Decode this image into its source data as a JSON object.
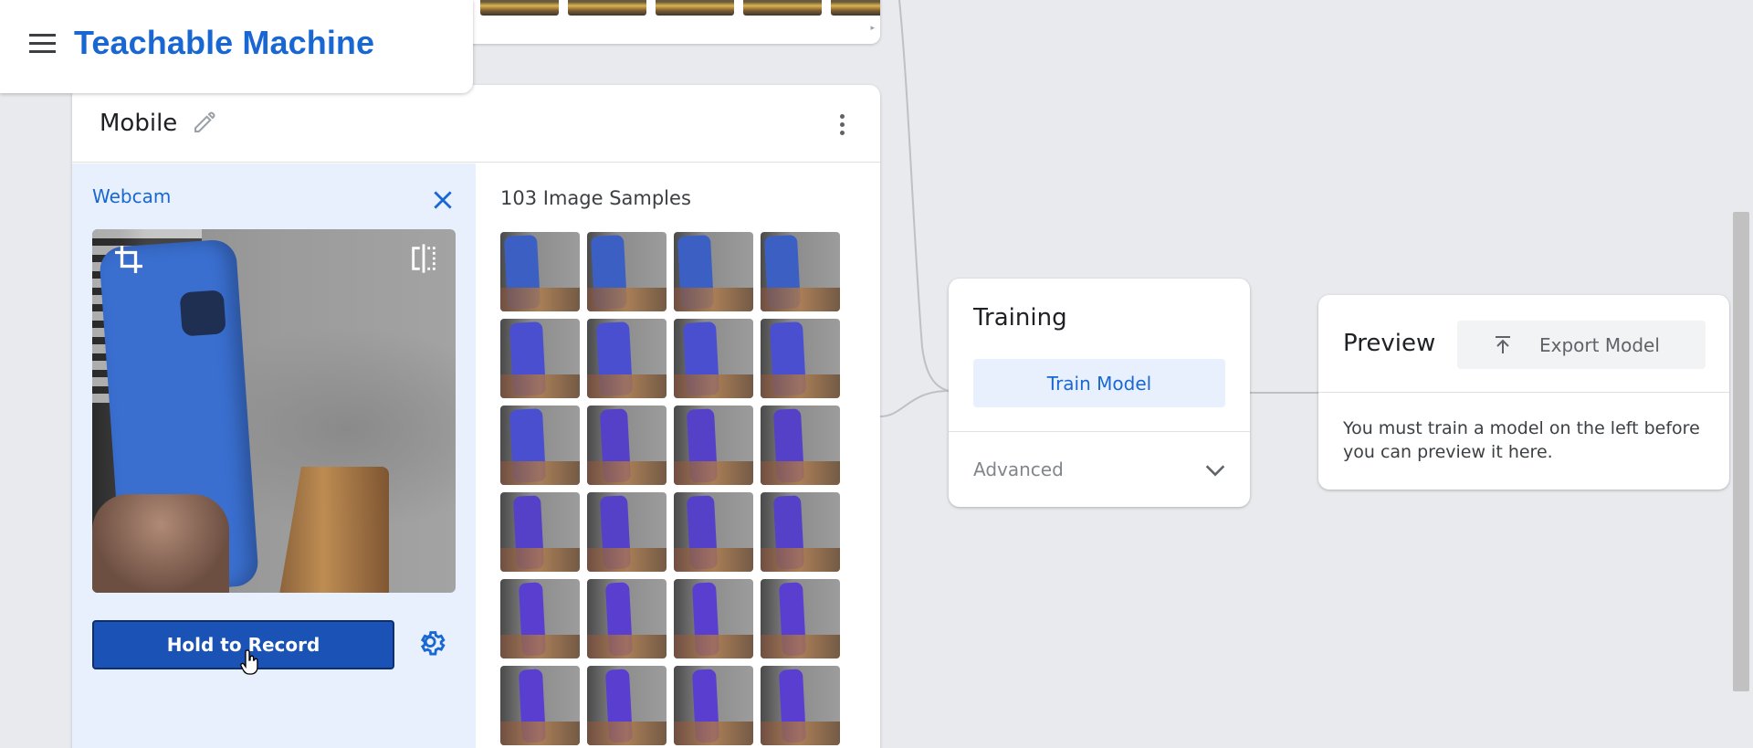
{
  "app": {
    "title": "Teachable Machine"
  },
  "class_card": {
    "name": "Mobile",
    "webcam": {
      "title": "Webcam",
      "record_label": "Hold to Record"
    },
    "samples": {
      "count_label": "103 Image Samples"
    }
  },
  "training": {
    "title": "Training",
    "train_label": "Train Model",
    "advanced_label": "Advanced"
  },
  "preview": {
    "title": "Preview",
    "export_label": "Export Model",
    "message": "You must train a model on the left before you can preview it here."
  },
  "colors": {
    "accent": "#1967d2",
    "record_button": "#1a53b5",
    "panel_bg": "#e8f0fe",
    "page_bg": "#e8eaed"
  },
  "icons": [
    "menu-icon",
    "edit-icon",
    "more-vert-icon",
    "close-icon",
    "crop-icon",
    "flip-icon",
    "settings-icon",
    "chevron-down-icon",
    "upload-icon"
  ]
}
